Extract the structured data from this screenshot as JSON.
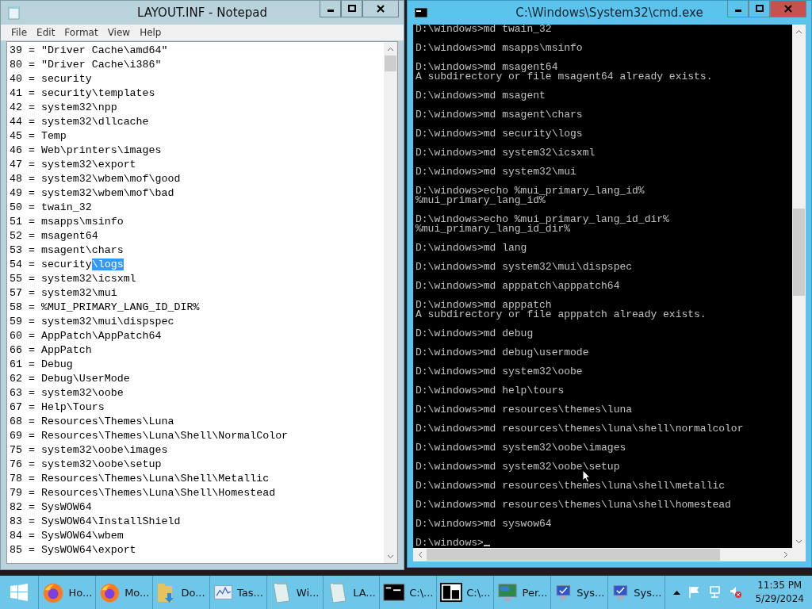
{
  "notepad": {
    "title": "LAYOUT.INF - Notepad",
    "menu": [
      "File",
      "Edit",
      "Format",
      "View",
      "Help"
    ],
    "lines": [
      {
        "text": "39 = \"Driver Cache\\amd64\""
      },
      {
        "text": "80 = \"Driver Cache\\i386\""
      },
      {
        "text": "40 = security"
      },
      {
        "text": "41 = security\\templates"
      },
      {
        "text": "42 = system32\\npp"
      },
      {
        "text": "44 = system32\\dllcache"
      },
      {
        "text": "45 = Temp"
      },
      {
        "text": "46 = Web\\printers\\images"
      },
      {
        "text": "47 = system32\\export"
      },
      {
        "text": "48 = system32\\wbem\\mof\\good"
      },
      {
        "text": "49 = system32\\wbem\\mof\\bad"
      },
      {
        "text": "50 = twain_32"
      },
      {
        "text": "51 = msapps\\msinfo"
      },
      {
        "text": "52 = msagent64"
      },
      {
        "text": "53 = msagent\\chars"
      },
      {
        "text": "54 = security",
        "selection": "\\logs"
      },
      {
        "text": "55 = system32\\icsxml"
      },
      {
        "text": "57 = system32\\mui"
      },
      {
        "text": "58 = %MUI_PRIMARY_LANG_ID_DIR%"
      },
      {
        "text": "59 = system32\\mui\\dispspec"
      },
      {
        "text": "60 = AppPatch\\AppPatch64"
      },
      {
        "text": "66 = AppPatch"
      },
      {
        "text": "61 = Debug"
      },
      {
        "text": "62 = Debug\\UserMode"
      },
      {
        "text": "63 = system32\\oobe"
      },
      {
        "text": "67 = Help\\Tours"
      },
      {
        "text": "68 = Resources\\Themes\\Luna"
      },
      {
        "text": "69 = Resources\\Themes\\Luna\\Shell\\NormalColor"
      },
      {
        "text": "75 = system32\\oobe\\images"
      },
      {
        "text": "76 = system32\\oobe\\setup"
      },
      {
        "text": "78 = Resources\\Themes\\Luna\\Shell\\Metallic"
      },
      {
        "text": "79 = Resources\\Themes\\Luna\\Shell\\Homestead"
      },
      {
        "text": "82 = SysWOW64"
      },
      {
        "text": "83 = SysWOW64\\InstallShield"
      },
      {
        "text": "84 = SysWOW64\\wbem"
      },
      {
        "text": "85 = SysWOW64\\export"
      }
    ]
  },
  "console": {
    "title": "C:\\Windows\\System32\\cmd.exe",
    "blocks": [
      {
        "input": "D:\\windows>md twain_32"
      },
      {
        "input": "D:\\windows>md msapps\\msinfo"
      },
      {
        "input": "D:\\windows>md msagent64",
        "output": [
          "A subdirectory or file msagent64 already exists."
        ]
      },
      {
        "input": "D:\\windows>md msagent"
      },
      {
        "input": "D:\\windows>md msagent\\chars"
      },
      {
        "input": "D:\\windows>md security\\logs"
      },
      {
        "input": "D:\\windows>md system32\\icsxml"
      },
      {
        "input": "D:\\windows>md system32\\mui"
      },
      {
        "input": "D:\\windows>echo %mui_primary_lang_id%",
        "output": [
          "%mui_primary_lang_id%"
        ]
      },
      {
        "input": "D:\\windows>echo %mui_primary_lang_id_dir%",
        "output": [
          "%mui_primary_lang_id_dir%"
        ]
      },
      {
        "input": "D:\\windows>md lang"
      },
      {
        "input": "D:\\windows>md system32\\mui\\dispspec"
      },
      {
        "input": "D:\\windows>md apppatch\\apppatch64"
      },
      {
        "input": "D:\\windows>md apppatch",
        "output": [
          "A subdirectory or file apppatch already exists."
        ]
      },
      {
        "input": "D:\\windows>md debug"
      },
      {
        "input": "D:\\windows>md debug\\usermode"
      },
      {
        "input": "D:\\windows>md system32\\oobe"
      },
      {
        "input": "D:\\windows>md help\\tours"
      },
      {
        "input": "D:\\windows>md resources\\themes\\luna"
      },
      {
        "input": "D:\\windows>md resources\\themes\\luna\\shell\\normalcolor"
      },
      {
        "input": "D:\\windows>md system32\\oobe\\images"
      },
      {
        "input": "D:\\windows>md system32\\oobe\\setup"
      },
      {
        "input": "D:\\windows>md resources\\themes\\luna\\shell\\metallic"
      },
      {
        "input": "D:\\windows>md resources\\themes\\luna\\shell\\homestead"
      },
      {
        "input": "D:\\windows>md syswow64"
      },
      {
        "input": "D:\\windows>"
      }
    ]
  },
  "taskbar": {
    "items": [
      {
        "kind": "firefox",
        "label": "Ho..."
      },
      {
        "kind": "firefox",
        "label": "Mo..."
      },
      {
        "kind": "folder",
        "label": "Do..."
      },
      {
        "kind": "taskmgr",
        "label": "Tas..."
      },
      {
        "kind": "notepad",
        "label": "Wi..."
      },
      {
        "kind": "notepad",
        "label": "LA..."
      },
      {
        "kind": "cmd",
        "label": "C:\\..."
      },
      {
        "kind": "archive",
        "label": "C:\\..."
      },
      {
        "kind": "monitor",
        "label": "Per..."
      },
      {
        "kind": "system",
        "label": "Sys..."
      },
      {
        "kind": "system",
        "label": "Sys..."
      }
    ],
    "time": "11:35 PM",
    "date": "5/29/2024"
  }
}
